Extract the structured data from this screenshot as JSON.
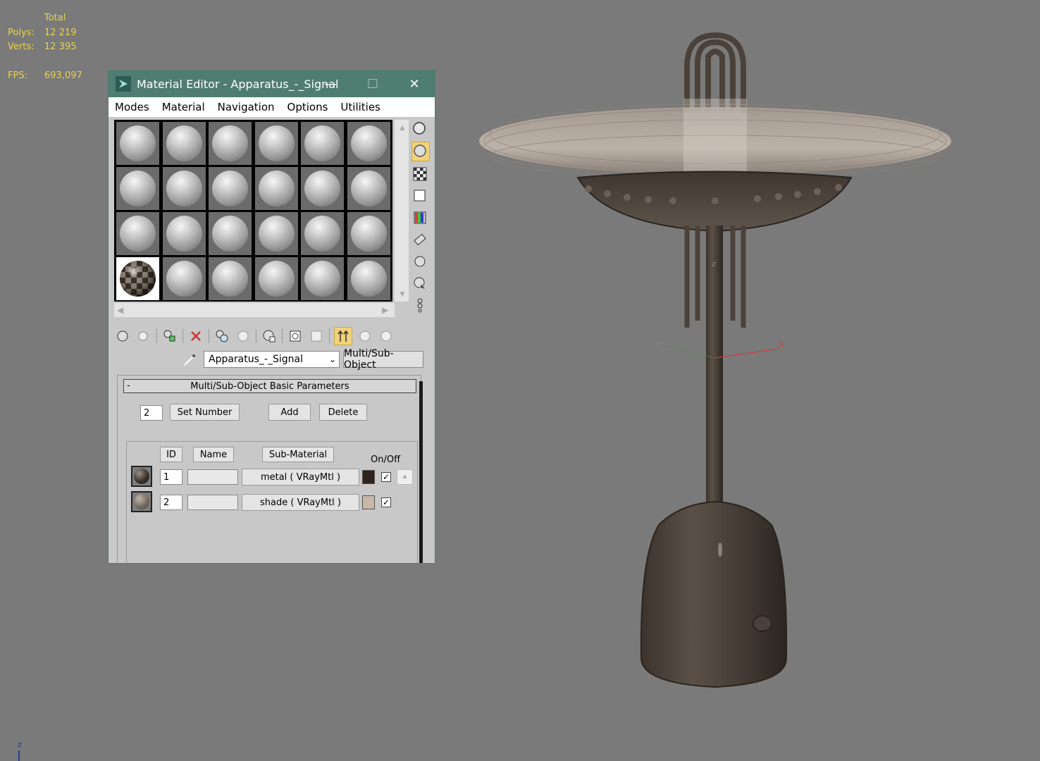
{
  "stats": {
    "header": "Total",
    "polys_label": "Polys:",
    "polys_value": "12 219",
    "verts_label": "Verts:",
    "verts_value": "12 395",
    "fps_label": "FPS:",
    "fps_value": "693,097"
  },
  "viewport": {
    "axis_x": "x",
    "axis_y": "y",
    "axis_z": "z",
    "corner_axis": "z"
  },
  "material_editor": {
    "title": "Material Editor - Apparatus_-_Signal",
    "minimize": "—",
    "maximize": "☐",
    "close": "✕",
    "menu": [
      "Modes",
      "Material",
      "Navigation",
      "Options",
      "Utilities"
    ],
    "material_name": "Apparatus_-_Signal",
    "material_type": "Multi/Sub-Object",
    "rollout_title": "Multi/Sub-Object Basic Parameters",
    "rollout_toggle": "-",
    "set_number_value": "2",
    "set_number_label": "Set Number",
    "add_label": "Add",
    "delete_label": "Delete",
    "col_id": "ID",
    "col_name": "Name",
    "col_submaterial": "Sub-Material",
    "col_onoff": "On/Off",
    "rows": [
      {
        "id": "1",
        "name": "",
        "submaterial": "metal  ( VRayMtl )",
        "color": "#2e241d",
        "checked": "✓"
      },
      {
        "id": "2",
        "name": "",
        "submaterial": "shade  ( VRayMtl )",
        "color": "#c8b8a8",
        "checked": "✓"
      }
    ]
  }
}
